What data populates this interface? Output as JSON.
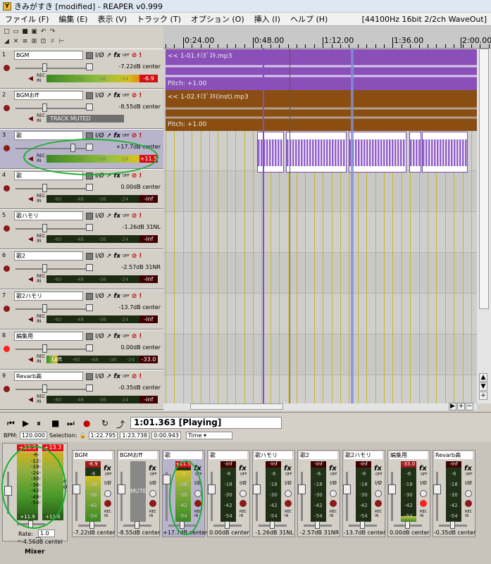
{
  "window": {
    "title": "きみがすき [modified] - REAPER v0.999",
    "min_icon": "minimize-icon"
  },
  "menu": {
    "items": [
      "ファイル (F)",
      "編集 (E)",
      "表示 (V)",
      "トラック (T)",
      "オプション (O)",
      "挿入 (I)",
      "ヘルプ (H)"
    ],
    "info": "[44100Hz 16bit 2/2ch WaveOut]"
  },
  "ruler": {
    "labels": [
      "0:24.00",
      "0:48.00",
      "1:12.00",
      "1:36.00",
      "2:00.00"
    ]
  },
  "tracks": [
    {
      "num": "1",
      "name": "BGM",
      "vol": "-7.22dB center",
      "peak": "-6.9",
      "peak_hot": true,
      "level": 0.86,
      "muted": false,
      "rec_on": false
    },
    {
      "num": "2",
      "name": "BGMおff",
      "vol": "-8.55dB center",
      "muted": true,
      "muted_label": "TRACK MUTED",
      "rec_on": false
    },
    {
      "num": "3",
      "name": "歌",
      "vol": "+17.7dB center",
      "peak": "+11.5",
      "peak_hot": true,
      "level": 0.96,
      "muted": false,
      "rec_on": false,
      "selected": true
    },
    {
      "num": "4",
      "name": "歌",
      "vol": "0.00dB center",
      "peak": "-inf",
      "peak_hot": false,
      "level": 0,
      "muted": false,
      "rec_on": false
    },
    {
      "num": "5",
      "name": "歌ハモリ",
      "vol": "-1.26dB 31NL",
      "peak": "-inf",
      "peak_hot": false,
      "level": 0,
      "muted": false,
      "rec_on": false
    },
    {
      "num": "6",
      "name": "歌2",
      "vol": "-2.57dB 31NR",
      "peak": "-inf",
      "peak_hot": false,
      "level": 0,
      "muted": false,
      "rec_on": false
    },
    {
      "num": "7",
      "name": "歌2ハモリ",
      "vol": "-13.7dB center",
      "peak": "-inf",
      "peak_hot": false,
      "level": 0,
      "muted": false,
      "rec_on": false
    },
    {
      "num": "8",
      "name": "編集用",
      "vol": "0.00dB center",
      "peak": "-33.0",
      "peak_hot": false,
      "level": 0.1,
      "meter_text": "Left",
      "muted": false,
      "rec_on": true
    },
    {
      "num": "9",
      "name": "Revarb高",
      "vol": "-0.35dB center",
      "peak": "-inf",
      "peak_hot": false,
      "level": 0,
      "muted": false,
      "rec_on": false
    }
  ],
  "meter_scale": [
    "-60",
    "-48",
    "-36",
    "-24",
    "-12"
  ],
  "track_icons": {
    "io": "I/Ø",
    "fx": "fx",
    "fx_sub": "OFF",
    "phase": "Ø",
    "rec_in": "REC\nIN"
  },
  "items": {
    "bgm_name": "<< 1-01.ｷﾐｶﾞｽｷ.mp3",
    "bgm_pitch": "Pitch: +1.00",
    "bgmoff_name": "<< 1-02.ｷﾐｶﾞｽｷ(inst).mp3",
    "bgmoff_pitch": "Pitch: +1.00"
  },
  "transport": {
    "position": "1:01.363 [Playing]",
    "bpm_label": "BPM:",
    "bpm": "120.000",
    "sel_label": "Selection:",
    "sel_start": "1:22.795",
    "sel_end": "1:23.738",
    "sel_len": "0:00.943",
    "mode": "Time"
  },
  "master": {
    "peak_l": "+13.3",
    "peak_r": "+13.3",
    "val_l": "+11.9",
    "val_r": "+11.0",
    "scale": [
      "-6-",
      "-12-",
      "-18-",
      "-24-",
      "-30-",
      "-36-",
      "-42-",
      "-48-",
      "-54-"
    ],
    "rate_label": "Rate:",
    "rate": "1.0",
    "vol": "-4.56dB center",
    "label": "Mixer",
    "io": "I/Ø"
  },
  "strips": [
    {
      "name": "BGM",
      "peak": "-6.9",
      "peak_class": "mid",
      "level": 0.85,
      "vol": "-7.22dB center"
    },
    {
      "name": "BGMおff",
      "muted": true,
      "mute_label": "MUTE",
      "vol": "-8.55dB center"
    },
    {
      "name": "歌",
      "peak": "+11.5",
      "peak_class": "hot",
      "level": 0.95,
      "vol": "+17.7dB center",
      "selected": true
    },
    {
      "name": "歌",
      "peak": "-inf",
      "level": 0,
      "vol": "0.00dB center"
    },
    {
      "name": "歌ハモリ",
      "peak": "-inf",
      "level": 0,
      "vol": "-1.26dB 31NL"
    },
    {
      "name": "歌2",
      "peak": "-inf",
      "level": 0,
      "vol": "-2.57dB 31NR"
    },
    {
      "name": "歌2ハモリ",
      "peak": "-inf",
      "level": 0,
      "vol": "-13.7dB center"
    },
    {
      "name": "編集用",
      "peak": "-33.0",
      "peak_class": "mid",
      "level": 0.1,
      "vol": "0.00dB center",
      "rec_on": true
    },
    {
      "name": "Revarb高",
      "peak": "-inf",
      "level": 0,
      "vol": "-0.35dB center"
    }
  ],
  "strip_scale": [
    "-6",
    "-18",
    "-30",
    "-42",
    "-54"
  ],
  "colors": {
    "bgm_item": "#8a4fb8",
    "bgmoff_item": "#8a4e12",
    "annotation": "#1ab030"
  }
}
